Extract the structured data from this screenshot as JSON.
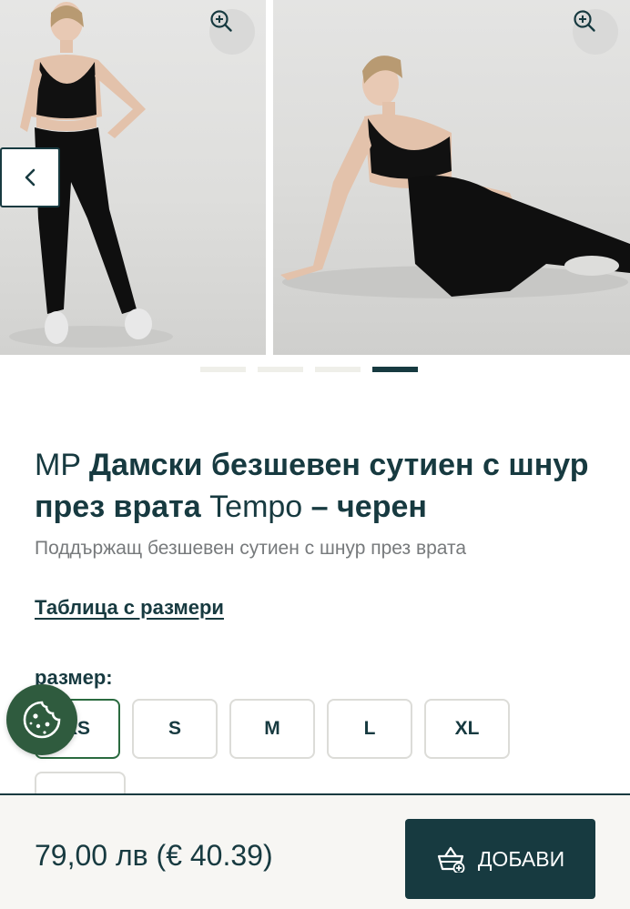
{
  "gallery": {
    "images": [
      {
        "alt": "model-standing-front",
        "icon": "zoom-icon"
      },
      {
        "alt": "model-seated-side",
        "icon": "zoom-icon"
      }
    ],
    "prev_icon": "chevron-left-icon",
    "dots": [
      false,
      false,
      false,
      true
    ]
  },
  "product": {
    "brand": "MP",
    "title_bold": "Дамски безшевен сутиен с шнур през врата",
    "title_regular": "Tempo",
    "title_dash": "–",
    "title_color": "черен",
    "subtitle": "Поддържащ безшевен сутиен с шнур през врата"
  },
  "size_chart_link": "Таблица с размери",
  "size": {
    "label": "размер:",
    "options": [
      "XS",
      "S",
      "M",
      "L",
      "XL"
    ],
    "selected": "XS"
  },
  "cookie_icon": "cookie-icon",
  "footer": {
    "price": "79,00 лв (€ 40.39)",
    "add_label": "ДОБАВИ",
    "add_icon": "cart-add-icon"
  },
  "colors": {
    "primary": "#173a40",
    "accent_green": "#2f5b3e",
    "selected_border": "#2a6a3f"
  }
}
